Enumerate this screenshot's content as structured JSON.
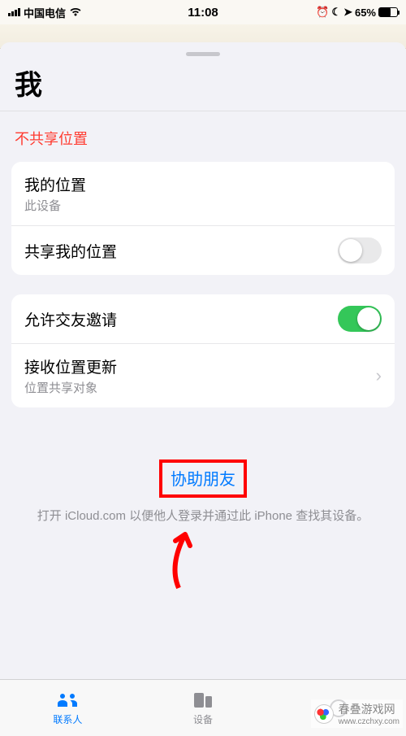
{
  "status": {
    "carrier": "中国电信",
    "time": "11:08",
    "battery_pct": "65%"
  },
  "sheet": {
    "title": "我",
    "not_sharing": "不共享位置"
  },
  "group1": {
    "my_location_label": "我的位置",
    "my_location_sub": "此设备",
    "share_label": "共享我的位置",
    "share_on": false
  },
  "group2": {
    "allow_label": "允许交友邀请",
    "allow_on": true,
    "receive_label": "接收位置更新",
    "receive_sub": "位置共享对象"
  },
  "help": {
    "link": "协助朋友",
    "desc": "打开 iCloud.com 以便他人登录并通过此 iPhone 查找其设备。"
  },
  "tabs": {
    "contacts": "联系人",
    "devices": "设备"
  },
  "watermark": {
    "text": "春叠游戏网",
    "url": "www.czchxy.com"
  }
}
